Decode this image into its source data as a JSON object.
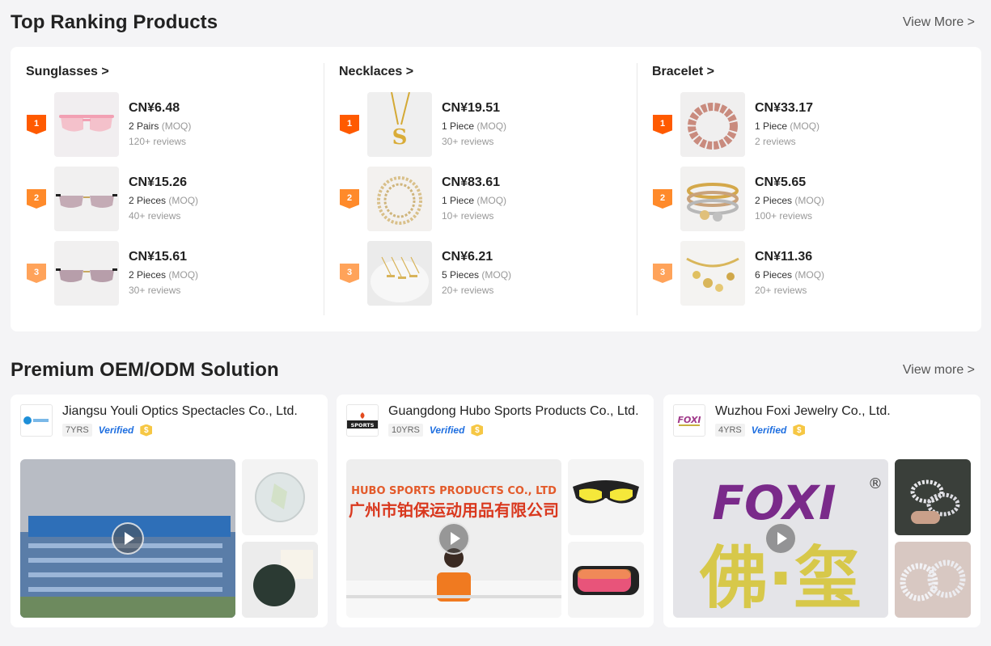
{
  "top_ranking": {
    "title": "Top Ranking Products",
    "view_more": "View More >",
    "categories": [
      {
        "title": "Sunglasses >",
        "items": [
          {
            "rank": "1",
            "price": "CN¥6.48",
            "moq": "2 Pairs",
            "moq_tag": "(MOQ)",
            "reviews": "120+ reviews",
            "image": "pink-sunglasses"
          },
          {
            "rank": "2",
            "price": "CN¥15.26",
            "moq": "2 Pieces",
            "moq_tag": "(MOQ)",
            "reviews": "40+ reviews",
            "image": "rimless-sunglasses"
          },
          {
            "rank": "3",
            "price": "CN¥15.61",
            "moq": "2 Pieces",
            "moq_tag": "(MOQ)",
            "reviews": "30+ reviews",
            "image": "rimless-sunglasses"
          }
        ]
      },
      {
        "title": "Necklaces >",
        "items": [
          {
            "rank": "1",
            "price": "CN¥19.51",
            "moq": "1 Piece",
            "moq_tag": "(MOQ)",
            "reviews": "30+ reviews",
            "image": "letter-s-necklace"
          },
          {
            "rank": "2",
            "price": "CN¥83.61",
            "moq": "1 Piece",
            "moq_tag": "(MOQ)",
            "reviews": "10+ reviews",
            "image": "tennis-chain"
          },
          {
            "rank": "3",
            "price": "CN¥6.21",
            "moq": "5 Pieces",
            "moq_tag": "(MOQ)",
            "reviews": "20+ reviews",
            "image": "bar-necklaces"
          }
        ]
      },
      {
        "title": "Bracelet >",
        "items": [
          {
            "rank": "1",
            "price": "CN¥33.17",
            "moq": "1 Piece",
            "moq_tag": "(MOQ)",
            "reviews": "2 reviews",
            "image": "cuban-bracelet"
          },
          {
            "rank": "2",
            "price": "CN¥5.65",
            "moq": "2 Pieces",
            "moq_tag": "(MOQ)",
            "reviews": "100+ reviews",
            "image": "charm-bangles"
          },
          {
            "rank": "3",
            "price": "CN¥11.36",
            "moq": "6 Pieces",
            "moq_tag": "(MOQ)",
            "reviews": "20+ reviews",
            "image": "charm-bracelet"
          }
        ]
      }
    ]
  },
  "oem": {
    "title": "Premium OEM/ODM Solution",
    "view_more": "View more >",
    "suppliers": [
      {
        "name": "Jiangsu Youli Optics Spectacles Co., Ltd.",
        "years": "7YRS",
        "verified": "Verified",
        "coin": "$"
      },
      {
        "name": "Guangdong Hubo Sports Products Co., Ltd.",
        "years": "10YRS",
        "verified": "Verified",
        "coin": "$",
        "logo_text": "SPORTS",
        "banner_en": "HUBO SPORTS PRODUCTS CO., LTD",
        "banner_cn": "广州市铂保运动用品有限公司"
      },
      {
        "name": "Wuzhou Foxi Jewelry Co., Ltd.",
        "years": "4YRS",
        "verified": "Verified",
        "coin": "$",
        "logo_text": "FOXI",
        "sign_en": "FOXI",
        "sign_reg": "®",
        "sign_cn": "佛·玺"
      }
    ]
  },
  "colors": {
    "rank1": "#ff5a00",
    "rank2": "#ff8a2a",
    "rank3": "#ffa35a",
    "verified": "#1f6fe0"
  }
}
